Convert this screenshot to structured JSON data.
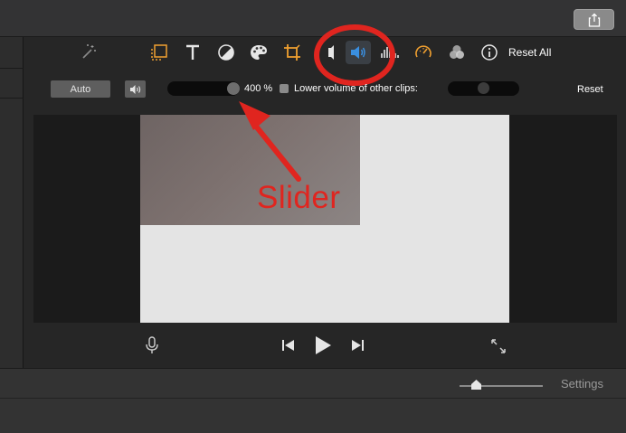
{
  "toolbar": {
    "items": [
      {
        "name": "magic-wand-icon"
      },
      {
        "name": "color-balance-icon",
        "color": "#f0a030"
      },
      {
        "name": "title-text-icon",
        "glyph": "T"
      },
      {
        "name": "color-correction-icon"
      },
      {
        "name": "palette-icon"
      },
      {
        "name": "crop-icon",
        "color": "#f0a030"
      },
      {
        "name": "stabilization-icon"
      },
      {
        "name": "volume-icon",
        "color": "#3a8fe0"
      },
      {
        "name": "noise-reduction-icon"
      },
      {
        "name": "speed-icon",
        "color": "#f0a030"
      },
      {
        "name": "clip-filter-icon"
      },
      {
        "name": "info-icon",
        "glyph": "i"
      }
    ],
    "reset_all_label": "Reset All"
  },
  "audio_controls": {
    "auto_label": "Auto",
    "volume_percent_label": "400 %",
    "volume_level": 1.0,
    "lower_volume_label": "Lower volume of other clips:",
    "lower_volume_checked": false,
    "lower_volume_level": 0.5,
    "reset_label": "Reset"
  },
  "annotation": {
    "label": "Slider",
    "color": "#e0251f"
  },
  "playback": {
    "mic_icon": "microphone-icon",
    "prev_icon": "skip-back-icon",
    "play_icon": "play-icon",
    "next_icon": "skip-forward-icon",
    "fullscreen_icon": "fullscreen-icon"
  },
  "bottom": {
    "settings_label": "Settings",
    "zoom_level": 0.2
  },
  "colors": {
    "accent_blue": "#3a8fe0",
    "accent_orange": "#f0a030",
    "annotation_red": "#e0251f"
  }
}
